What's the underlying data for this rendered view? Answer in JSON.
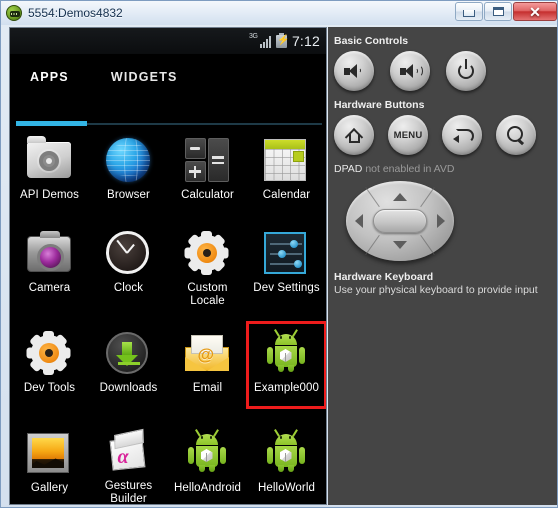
{
  "window": {
    "title": "5554:Demos4832",
    "icon": "android-emulator-icon",
    "controls": {
      "minimize_label": "–",
      "maximize_label": "□",
      "close_label": "✕"
    }
  },
  "device": {
    "statusbar": {
      "network_type": "3G",
      "signal_icon": "signal-bars-icon",
      "battery_icon": "battery-charging-icon",
      "time": "7:12"
    },
    "tabs": [
      {
        "label": "APPS",
        "active": true
      },
      {
        "label": "WIDGETS",
        "active": false
      }
    ],
    "accent_color": "#33b5e5",
    "selection_color": "#ee1c1c",
    "apps": [
      {
        "label": "API Demos",
        "icon": "api-demos-icon",
        "selected": false
      },
      {
        "label": "Browser",
        "icon": "browser-globe-icon",
        "selected": false
      },
      {
        "label": "Calculator",
        "icon": "calculator-icon",
        "selected": false
      },
      {
        "label": "Calendar",
        "icon": "calendar-icon",
        "selected": false
      },
      {
        "label": "Camera",
        "icon": "camera-icon",
        "selected": false
      },
      {
        "label": "Clock",
        "icon": "clock-icon",
        "selected": false
      },
      {
        "label": "Custom\nLocale",
        "icon": "custom-locale-icon",
        "selected": false
      },
      {
        "label": "Dev Settings",
        "icon": "dev-settings-icon",
        "selected": false
      },
      {
        "label": "Dev Tools",
        "icon": "dev-tools-icon",
        "selected": false
      },
      {
        "label": "Downloads",
        "icon": "downloads-icon",
        "selected": false
      },
      {
        "label": "Email",
        "icon": "email-icon",
        "selected": false
      },
      {
        "label": "Example000",
        "icon": "android-robot-icon",
        "selected": true
      },
      {
        "label": "Gallery",
        "icon": "gallery-icon",
        "selected": false
      },
      {
        "label": "Gestures\nBuilder",
        "icon": "gestures-builder-icon",
        "selected": false
      },
      {
        "label": "HelloAndroid",
        "icon": "android-robot-icon",
        "selected": false
      },
      {
        "label": "HelloWorld",
        "icon": "android-robot-icon",
        "selected": false
      }
    ],
    "app_labels": {
      "api_demos": "API Demos",
      "browser": "Browser",
      "calculator": "Calculator",
      "calendar": "Calendar",
      "camera": "Camera",
      "clock": "Clock",
      "custom_locale_line1": "Custom",
      "custom_locale_line2": "Locale",
      "dev_settings": "Dev Settings",
      "dev_tools": "Dev Tools",
      "downloads": "Downloads",
      "email": "Email",
      "example000": "Example000",
      "gallery": "Gallery",
      "gestures_line1": "Gestures",
      "gestures_line2": "Builder",
      "hello_android": "HelloAndroid",
      "hello_world": "HelloWorld"
    }
  },
  "panel": {
    "basic_controls_title": "Basic Controls",
    "basic_controls": [
      {
        "name": "volume-down-button",
        "icon": "speaker-low-icon"
      },
      {
        "name": "volume-up-button",
        "icon": "speaker-high-icon"
      },
      {
        "name": "power-button",
        "icon": "power-icon"
      }
    ],
    "hardware_buttons_title": "Hardware Buttons",
    "hardware_buttons": [
      {
        "name": "home-button",
        "icon": "home-icon",
        "label": ""
      },
      {
        "name": "menu-button",
        "icon": "menu-icon",
        "label": "MENU"
      },
      {
        "name": "back-button",
        "icon": "back-arrow-icon",
        "label": ""
      },
      {
        "name": "search-button",
        "icon": "search-icon",
        "label": ""
      }
    ],
    "menu_button_label": "MENU",
    "dpad_label": "DPAD",
    "dpad_status": " not enabled in AVD",
    "keyboard_title": "Hardware Keyboard",
    "keyboard_sub": "Use your physical keyboard to provide input"
  }
}
